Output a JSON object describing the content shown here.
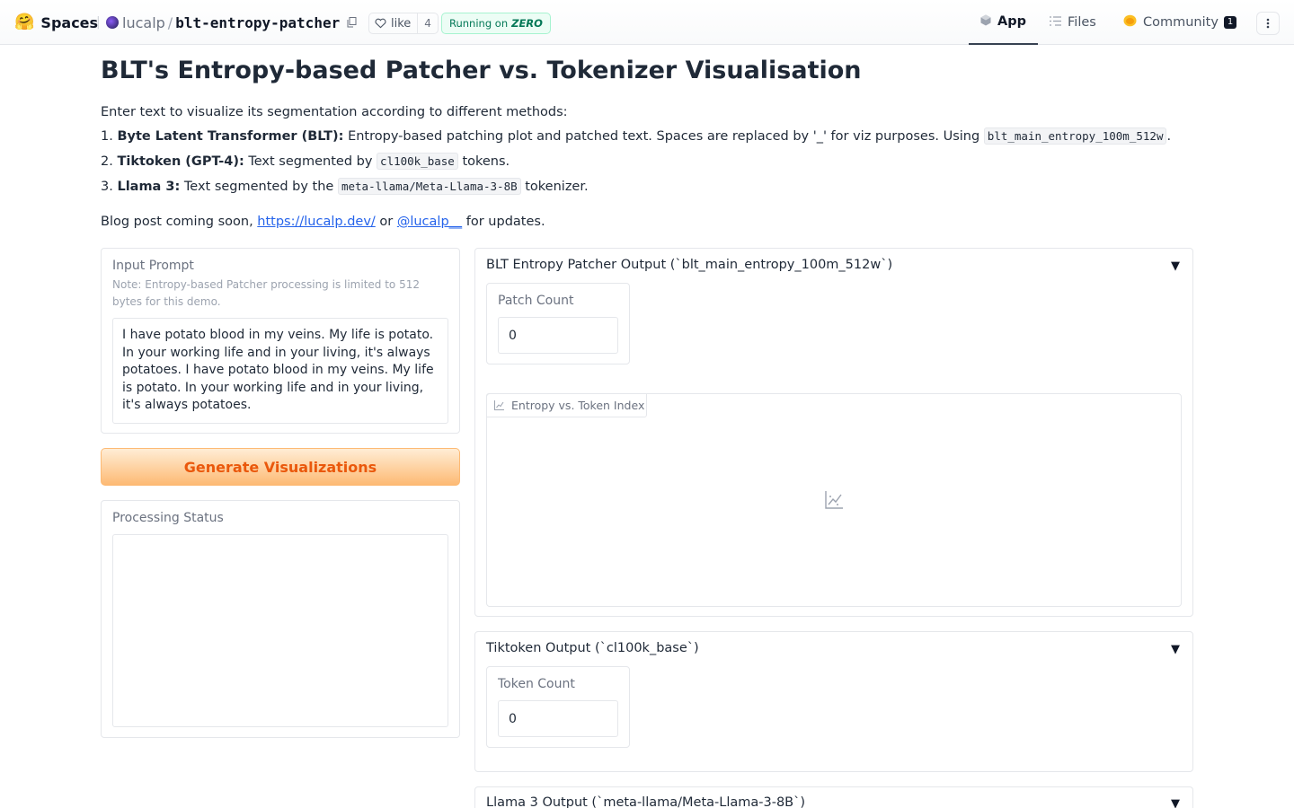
{
  "header": {
    "logo_emoji": "🤗",
    "logo_text": "Spaces",
    "owner": "lucalp",
    "repo": "blt-entropy-patcher",
    "like_label": "like",
    "like_count": "4",
    "running_label": "Running on",
    "running_hw": "ZERO",
    "tabs": [
      {
        "label": "App",
        "icon": "cube-icon",
        "active": true
      },
      {
        "label": "Files",
        "icon": "files-icon",
        "active": false
      },
      {
        "label": "Community",
        "icon": "community-icon",
        "active": false,
        "badge": "1"
      }
    ],
    "more_icon": "more-vertical-icon"
  },
  "page": {
    "title": "BLT's Entropy-based Patcher vs. Tokenizer Visualisation",
    "intro": "Enter text to visualize its segmentation according to different methods:",
    "methods": [
      {
        "num": "1.",
        "name": "Byte Latent Transformer (BLT):",
        "desc": "Entropy-based patching plot and patched text. Spaces are replaced by '_' for viz purposes. Using",
        "code": "blt_main_entropy_100m_512w",
        "after": "."
      },
      {
        "num": "2.",
        "name": "Tiktoken (GPT-4):",
        "desc": "Text segmented by",
        "code": "cl100k_base",
        "after": "tokens."
      },
      {
        "num": "3.",
        "name": "Llama 3:",
        "desc": "Text segmented by the",
        "code": "meta-llama/Meta-Llama-3-8B",
        "after": "tokenizer."
      }
    ],
    "blog_prefix": "Blog post coming soon,",
    "blog_link": "https://lucalp.dev/",
    "blog_or": "or",
    "blog_handle": "@lucalp__",
    "blog_suffix": "for updates."
  },
  "input": {
    "label": "Input Prompt",
    "note": "Note: Entropy-based Patcher processing is limited to 512 bytes for this demo.",
    "text": "I have potato blood in my veins. My life is potato. In your working life and in your living, it's always potatoes. I have potato blood in my veins. My life is potato. In your working life and in your living, it's always potatoes."
  },
  "generate_label": "Generate Visualizations",
  "status": {
    "label": "Processing Status",
    "value": ""
  },
  "blt": {
    "title": "BLT Entropy Patcher Output (`blt_main_entropy_100m_512w`)",
    "count_label": "Patch Count",
    "count_value": "0",
    "plot_label": "Entropy vs. Token Index"
  },
  "tiktoken": {
    "title": "Tiktoken Output (`cl100k_base`)",
    "count_label": "Token Count",
    "count_value": "0"
  },
  "llama": {
    "title": "Llama 3 Output (`meta-llama/Meta-Llama-3-8B`)"
  },
  "caret": "▼"
}
